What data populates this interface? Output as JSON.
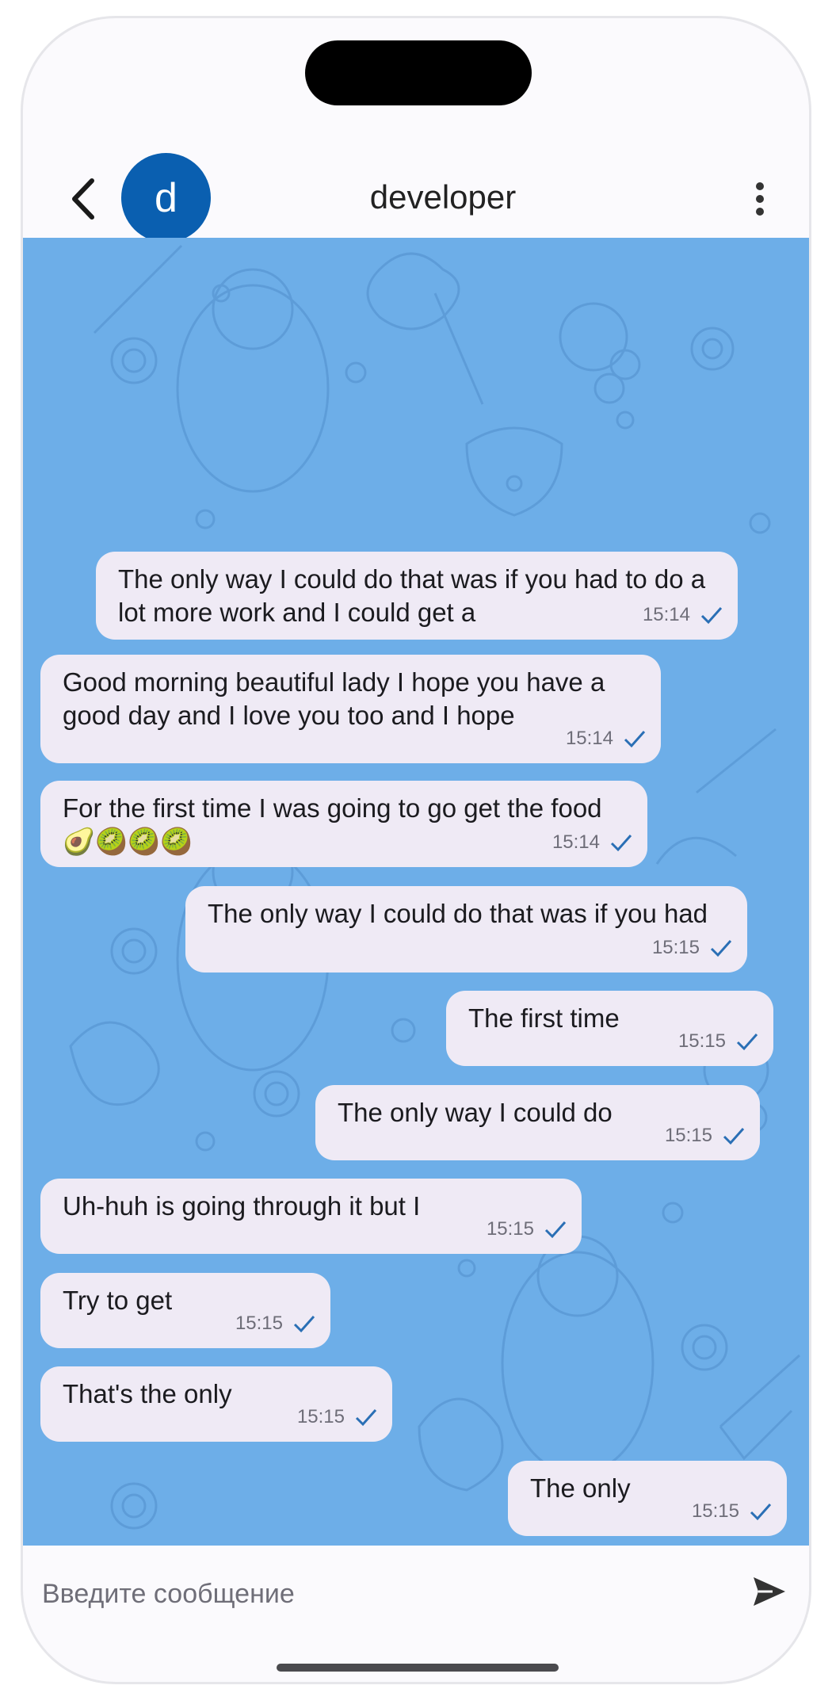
{
  "header": {
    "avatar_letter": "d",
    "contact_name": "developer"
  },
  "messages": [
    {
      "text": "The only way I could do that was if you had to do a lot more work and I could get a",
      "time": "15:14",
      "direction": "outgoing"
    },
    {
      "text": "Good morning beautiful lady I hope you have a good day and I love you too and I hope",
      "time": "15:14",
      "direction": "incoming"
    },
    {
      "text": "For the first time I was going to go get the food 🥑🥝🥝🥝",
      "time": "15:14",
      "direction": "incoming"
    },
    {
      "text": "The only way I could do that was if you had",
      "time": "15:15",
      "direction": "outgoing"
    },
    {
      "text": "The first time",
      "time": "15:15",
      "direction": "outgoing"
    },
    {
      "text": "The only way I could do",
      "time": "15:15",
      "direction": "outgoing"
    },
    {
      "text": "Uh-huh is going through it but I",
      "time": "15:15",
      "direction": "incoming"
    },
    {
      "text": "Try to get",
      "time": "15:15",
      "direction": "incoming"
    },
    {
      "text": "That's the only",
      "time": "15:15",
      "direction": "incoming"
    },
    {
      "text": "The only",
      "time": "15:15",
      "direction": "outgoing"
    }
  ],
  "composer": {
    "placeholder": "Введите сообщение",
    "value": ""
  },
  "colors": {
    "chat_background": "#6daee8",
    "bubble": "#efeaf5",
    "avatar": "#0a5fb0",
    "checkmark": "#2a6fb5"
  },
  "icons": {
    "back": "chevron-left-icon",
    "menu": "more-vertical-icon",
    "send": "send-icon",
    "status": "check-icon"
  }
}
